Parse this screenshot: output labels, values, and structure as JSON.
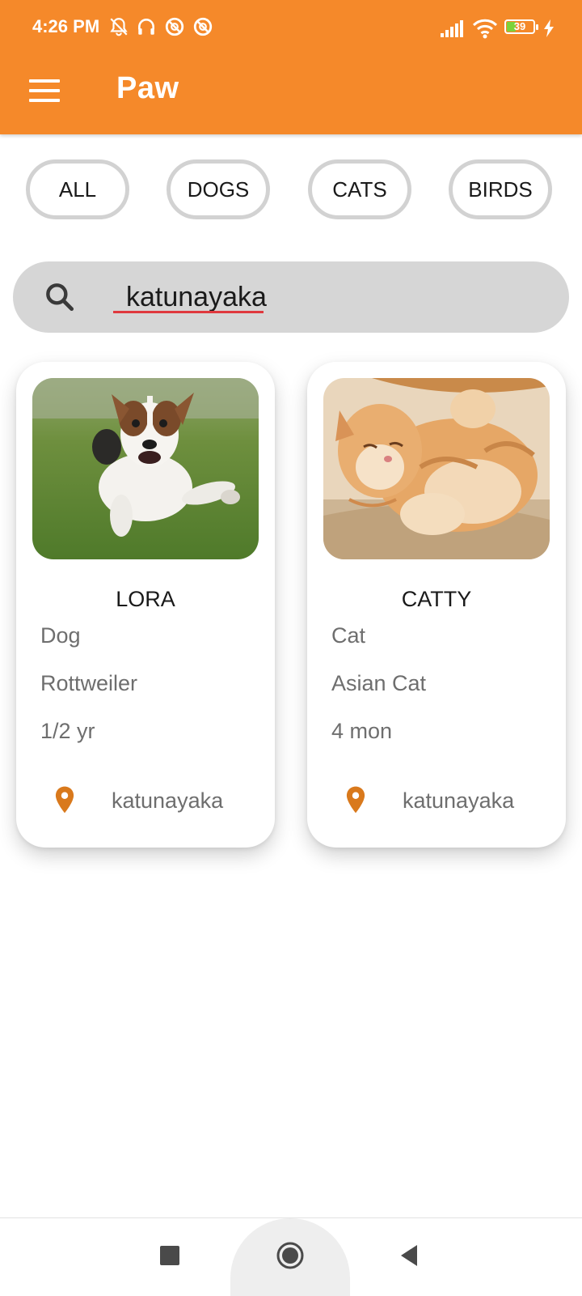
{
  "status_bar": {
    "time": "4:26 PM",
    "battery": "39",
    "icons": [
      "notifications-off-icon",
      "headset-icon",
      "block-icon",
      "block-icon",
      "signal-icon",
      "wifi-icon",
      "battery-icon",
      "charging-icon"
    ]
  },
  "app_bar": {
    "title": "Paw",
    "menu_icon": "hamburger-menu-icon",
    "color": "#F5892A"
  },
  "filters": [
    {
      "label": "ALL"
    },
    {
      "label": "DOGS"
    },
    {
      "label": "CATS"
    },
    {
      "label": "BIRDS"
    }
  ],
  "search": {
    "value": "katunayaka",
    "icon": "search-icon"
  },
  "pets": [
    {
      "name": "LORA",
      "type": "Dog",
      "breed": "Rottweiler",
      "age": "1/2 yr",
      "location": "katunayaka",
      "photo": "dog-photo"
    },
    {
      "name": "CATTY",
      "type": "Cat",
      "breed": "Asian Cat",
      "age": "4 mon",
      "location": "katunayaka",
      "photo": "cat-photo"
    }
  ],
  "colors": {
    "accent": "#F5892A",
    "pin": "#D9791C",
    "chip_border": "#D2D2D2",
    "search_bg": "#D6D6D6"
  },
  "nav_bar": {
    "buttons": [
      "recents-square-icon",
      "home-circle-icon",
      "back-triangle-icon"
    ]
  }
}
